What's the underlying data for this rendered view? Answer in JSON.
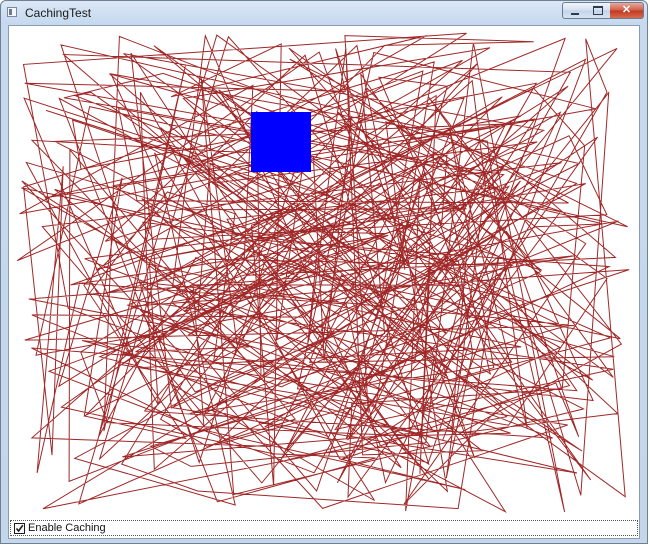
{
  "window": {
    "title": "CachingTest"
  },
  "titlebar": {
    "controls": [
      {
        "name": "minimize",
        "icon": "minimize-icon"
      },
      {
        "name": "maximize",
        "icon": "maximize-icon"
      },
      {
        "name": "close",
        "icon": "close-icon",
        "glyph": "✕"
      }
    ]
  },
  "canvas": {
    "line_color": "#9b1c1c",
    "rect_color": "#0000ff",
    "background": "#ffffff"
  },
  "options": {
    "enable_caching_label": "Enable Caching",
    "enable_caching_checked": true
  }
}
